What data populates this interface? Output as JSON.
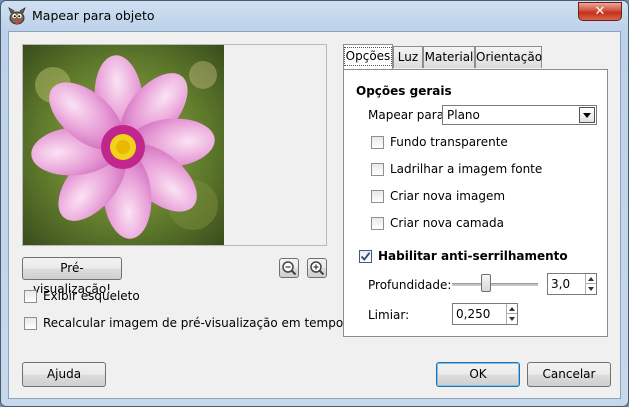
{
  "window": {
    "title": "Mapear para objeto",
    "close_glyph": "✕",
    "app_icon": "gimp-icon"
  },
  "preview": {
    "button_label": "Pré-visualização!",
    "zoom_out_icon": "zoom-out-icon",
    "zoom_in_icon": "zoom-in-icon",
    "show_wireframe": {
      "label": "Exibir esqueleto",
      "checked": false
    },
    "realtime_recalc": {
      "label": "Recalcular imagem de pré-visualização em tempo real",
      "checked": false
    }
  },
  "tabs": [
    {
      "label": "Opções",
      "active": true
    },
    {
      "label": "Luz",
      "active": false
    },
    {
      "label": "Material",
      "active": false
    },
    {
      "label": "Orientação",
      "active": false
    }
  ],
  "options": {
    "section_title": "Opções gerais",
    "map_to_label": "Mapear para:",
    "map_to_value": "Plano",
    "transparent_bg": {
      "label": "Fundo transparente",
      "checked": false
    },
    "tile_source": {
      "label": "Ladrilhar a imagem fonte",
      "checked": false
    },
    "new_image": {
      "label": "Criar nova imagem",
      "checked": false
    },
    "new_layer": {
      "label": "Criar nova camada",
      "checked": false
    },
    "antialias": {
      "label": "Habilitar anti-serrilhamento",
      "checked": true
    },
    "depth_label": "Profundidade:",
    "depth_value": "3,0",
    "depth_slider_fraction": 0.38,
    "threshold_label": "Limiar:",
    "threshold_value": "0,250"
  },
  "buttons": {
    "help": "Ajuda",
    "ok": "OK",
    "cancel": "Cancelar"
  },
  "colors": {
    "close_red": "#c1301b",
    "check_blue": "#3d5a80"
  }
}
